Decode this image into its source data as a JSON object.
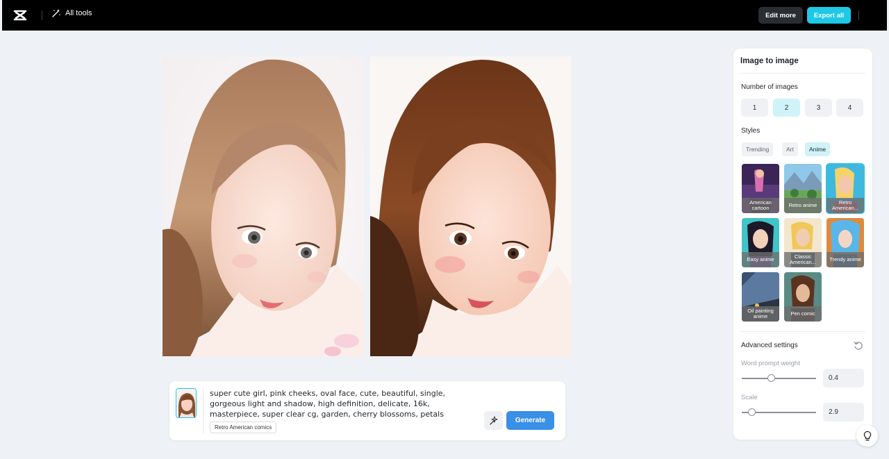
{
  "header": {
    "all_tools_label": "All tools",
    "edit_more_label": "Edit more",
    "export_all_label": "Export all"
  },
  "prompt": {
    "text": "super cute girl, pink cheeks, oval face, cute, beautiful, single, gorgeous light and shadow, high definition, delicate, 16k, masterpiece, super clear cg, garden, cherry blossoms, petals",
    "style_tag": "Retro American comics",
    "generate_label": "Generate"
  },
  "panel": {
    "title": "Image to image",
    "number_label": "Number of images",
    "numbers": [
      "1",
      "2",
      "3",
      "4"
    ],
    "selected_number": "2",
    "styles_label": "Styles",
    "style_tabs": [
      "Trending",
      "Art",
      "Anime"
    ],
    "active_tab": "Anime",
    "styles": [
      "American cartoon",
      "Retro anime",
      "Retro American...",
      "Easy anime",
      "Classic American...",
      "Trendy anime",
      "Oil painting anime",
      "Pen comic"
    ],
    "selected_style": "Retro American...",
    "advanced_label": "Advanced settings",
    "word_weight_label": "Word prompt weight",
    "word_weight_value": "0.4",
    "scale_label": "Scale",
    "scale_value": "2.9"
  },
  "colors": {
    "accent": "#1ec8e6",
    "generate": "#3a8fe6",
    "background": "#eef1f5"
  }
}
